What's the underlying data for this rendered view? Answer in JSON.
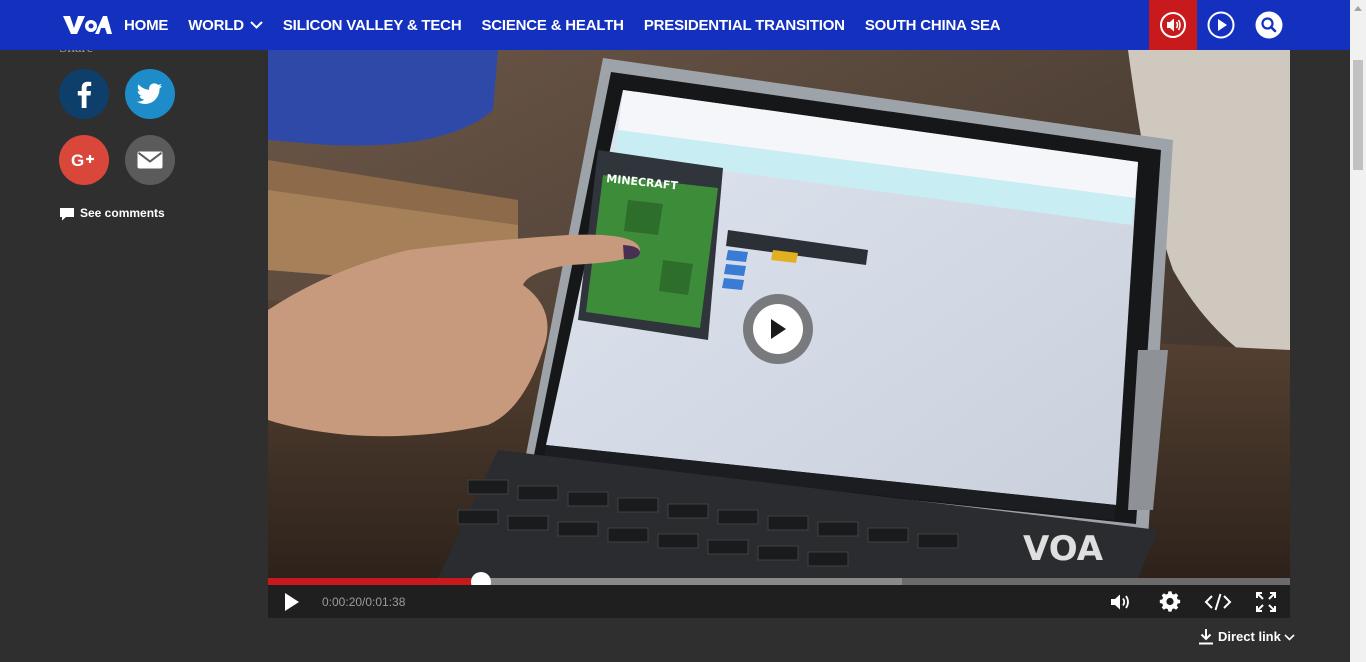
{
  "nav": {
    "logo_text": "VOA",
    "items": [
      {
        "label": "HOME"
      },
      {
        "label": "WORLD"
      },
      {
        "label": "SILICON VALLEY & TECH"
      },
      {
        "label": "SCIENCE & HEALTH"
      },
      {
        "label": "PRESIDENTIAL TRANSITION"
      },
      {
        "label": "SOUTH CHINA SEA"
      }
    ],
    "icons": [
      "audio-icon",
      "play-circle-icon",
      "search-icon"
    ]
  },
  "share": {
    "label": "Share",
    "buttons": [
      "facebook-icon",
      "twitter-icon",
      "google-plus-icon",
      "email-icon"
    ],
    "comments_label": "See comments"
  },
  "player": {
    "time_text": "0:00:20/0:01:38",
    "progress_fraction": 0.2084,
    "buffered_fraction": 0.6205,
    "watermark": "VOA",
    "screen_title": "MINECRAFT",
    "direct_link_label": "Direct link"
  },
  "colors": {
    "nav_bg": "#1330bf",
    "audio_bg": "#c8191c",
    "page_bg": "#2f2f2f",
    "progress_played": "#c8191c"
  }
}
